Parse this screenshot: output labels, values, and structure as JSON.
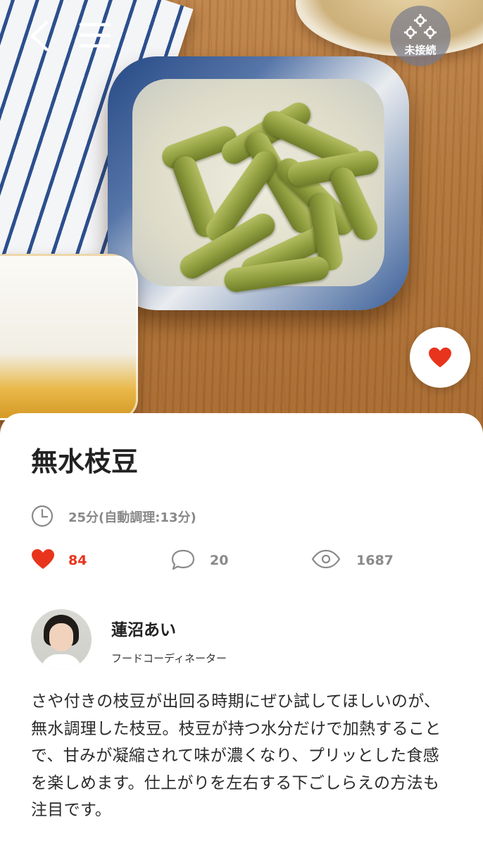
{
  "header": {
    "connection_status": "未接続"
  },
  "recipe": {
    "title": "無水枝豆",
    "time": "25分(自動調理:13分)",
    "likes": "84",
    "comments": "20",
    "views": "1687",
    "description": "さや付きの枝豆が出回る時期にぜひ試してほしいのが、無水調理した枝豆。枝豆が持つ水分だけで加熱することで、甘みが凝縮されて味が濃くなり、プリッとした食感を楽しめます。仕上がりを左右する下ごしらえの方法も注目です。"
  },
  "author": {
    "name": "蓮沼あい",
    "role": "フードコーディネーター"
  },
  "icons": {
    "back": "chevron-left-icon",
    "menu": "hamburger-menu-icon",
    "connection": "gears-icon",
    "favorite": "heart-icon",
    "time": "clock-icon",
    "likes": "heart-icon",
    "comments": "speech-bubble-icon",
    "views": "eye-icon"
  },
  "colors": {
    "accent": "#e8341c",
    "muted_text": "#888888",
    "title_text": "#222222"
  }
}
